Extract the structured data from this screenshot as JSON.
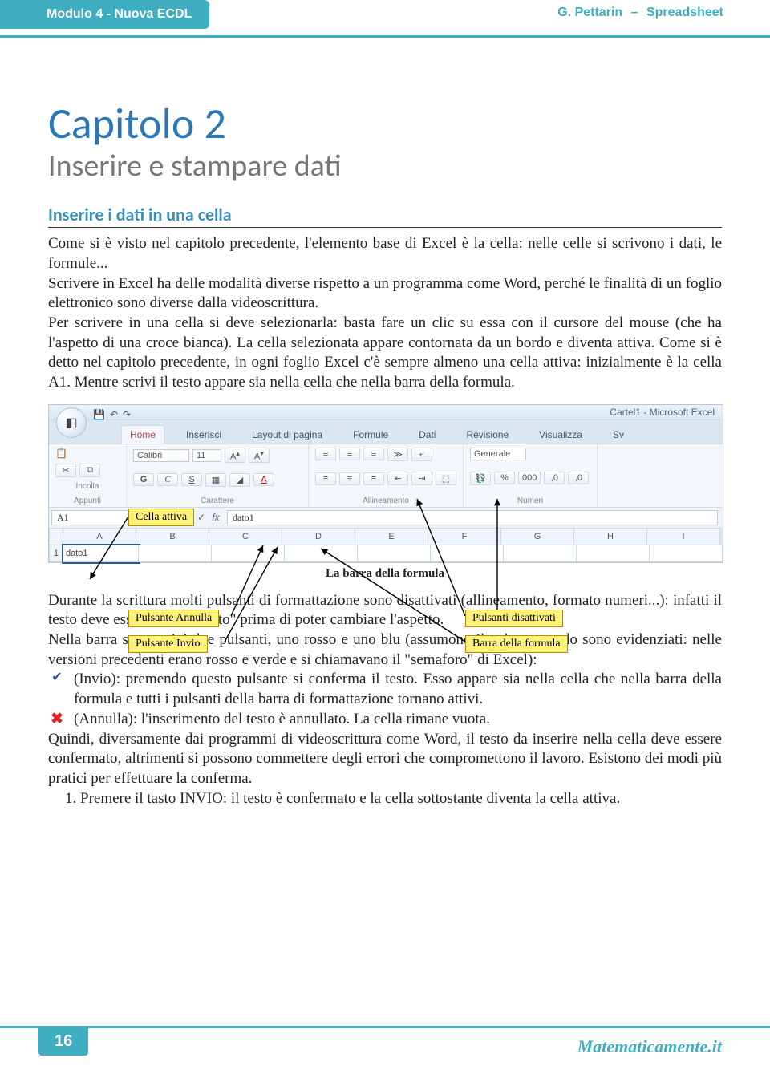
{
  "header": {
    "left": "Modulo 4 - Nuova ECDL",
    "author": "G. Pettarin",
    "sep": "–",
    "title": "Spreadsheet"
  },
  "chapter": {
    "title": "Capitolo 2",
    "subtitle": "Inserire e stampare dati"
  },
  "section_h": "Inserire i dati in una cella",
  "para1": "Come si è visto nel capitolo precedente, l'elemento base di Excel è la cella: nelle celle si scrivono i dati, le formule...",
  "para2": "Scrivere in Excel ha delle modalità diverse rispetto a un programma come Word, perché le finalità di un foglio elettronico sono diverse dalla videoscrittura.",
  "para3": "Per scrivere in una cella si deve selezionarla: basta fare un clic su essa con il cursore del mouse (che ha l'aspetto di una croce bianca). La cella selezionata appare contornata da un bordo e diventa attiva. Come si è detto nel capitolo precedente, in ogni foglio Excel c'è sempre almeno una cella attiva: inizialmente è la cella A1. Mentre scrivi il testo appare sia nella cella che nella barra della formula.",
  "excel": {
    "win_title": "Cartel1 - Microsoft Excel",
    "tabs": [
      "Home",
      "Inserisci",
      "Layout di pagina",
      "Formule",
      "Dati",
      "Revisione",
      "Visualizza",
      "Sv"
    ],
    "groups": {
      "appunti": "Appunti",
      "carattere": "Carattere",
      "alli": "Allineamento",
      "numeri": "Numeri"
    },
    "paste": "Incolla",
    "font": "Calibri",
    "size": "11",
    "fmt": "Generale",
    "numfmt": {
      "pct": "%",
      "zeros": "000",
      "dec": ",0"
    },
    "fx": "fx",
    "namebox": "A1",
    "fbar_val": "dato1",
    "cols": [
      "A",
      "B",
      "C",
      "D",
      "E",
      "F",
      "G",
      "H",
      "I"
    ],
    "row1": "1",
    "a1": "dato1"
  },
  "labels": {
    "cella_attiva": "Cella attiva",
    "annulla": "Pulsante Annulla",
    "invio": "Pulsante Invio",
    "disattivati": "Pulsanti disattivati",
    "barra_formula": "Barra della formula"
  },
  "fig_caption": "La barra della formula",
  "para4": "Durante la scrittura molti pulsanti di formattazione sono disattivati (allineamento, formato numeri...): infatti il testo deve essere \"confermato\" prima di poter cambiare l'aspetto.",
  "para5": "Nella barra sono attivi due pulsanti, uno rosso e uno blu (assumono il colore quando sono evidenziati: nelle versioni precedenti erano rosso e verde e si chiamavano il \"semaforo\" di Excel):",
  "bullet_invio": "(Invio): premendo questo pulsante si conferma il testo. Esso appare sia nella cella che nella barra della formula e tutti i pulsanti della barra di formattazione tornano attivi.",
  "bullet_annulla": "(Annulla): l'inserimento del testo è annullato. La cella rimane vuota.",
  "para6": "Quindi, diversamente dai programmi di videoscrittura come Word, il testo da inserire nella cella deve essere confermato, altrimenti si possono commettere degli errori che compromettono il lavoro.  Esistono dei modi più pratici per effettuare la conferma.",
  "ol1": "Premere il tasto INVIO: il testo è confermato e la cella sottostante diventa la cella attiva.",
  "footer": {
    "page": "16",
    "brand": "Matematicamente.it"
  }
}
